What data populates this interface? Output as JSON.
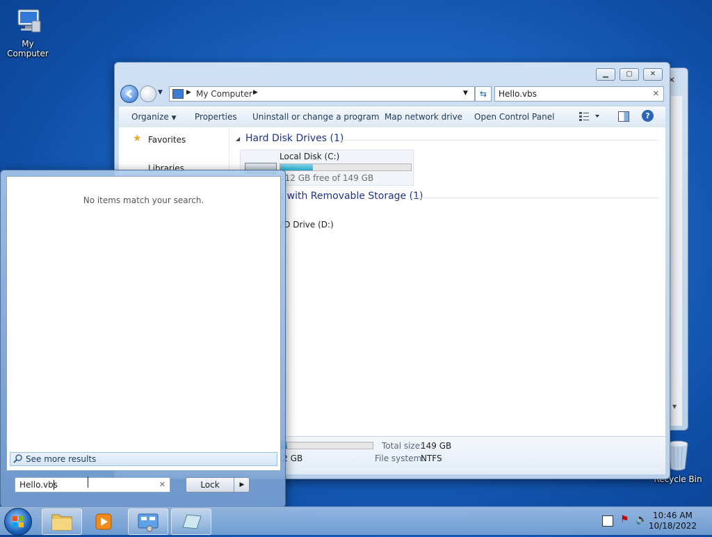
{
  "desktop": {
    "icons": [
      {
        "label": "My Computer"
      },
      {
        "label": "Recycle Bin"
      }
    ]
  },
  "explorer": {
    "address": {
      "path_root": "My Computer"
    },
    "search": {
      "value": "Hello.vbs"
    },
    "toolbar": {
      "organize": "Organize",
      "properties": "Properties",
      "uninstall": "Uninstall or change a program",
      "map_drive": "Map network drive",
      "control_panel": "Open Control Panel"
    },
    "nav": {
      "favorites": "Favorites",
      "libraries": "Libraries"
    },
    "groups": {
      "hdd_title": "Hard Disk Drives (1)",
      "removable_title": "Devices with Removable Storage (1)"
    },
    "drives": {
      "c_name": "Local Disk (C:)",
      "c_free": "112 GB free of 149 GB",
      "c_fill": 0.25,
      "d_name": "DVD Drive (D:)"
    },
    "details": {
      "free_value": "112 GB",
      "fill": 0.25,
      "total_label": "Total size:",
      "total_value": "149 GB",
      "fs_label": "File system:",
      "fs_value": "NTFS"
    }
  },
  "start_menu": {
    "no_results": "No items match your search.",
    "see_more": "See more results",
    "search_value": "Hello.vbs",
    "lock_label": "Lock"
  },
  "taskbar": {
    "time": "10:46 AM",
    "date": "10/18/2022"
  },
  "colors": {
    "accent": "#1e3287",
    "progress": "#27a6c9"
  }
}
